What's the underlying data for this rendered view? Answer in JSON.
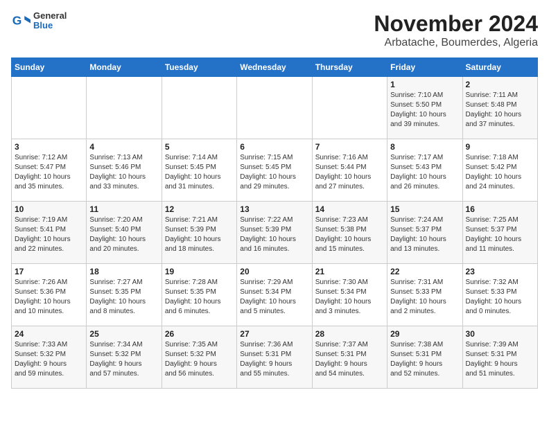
{
  "header": {
    "logo_line1": "General",
    "logo_line2": "Blue",
    "title": "November 2024",
    "subtitle": "Arbatache, Boumerdes, Algeria"
  },
  "weekdays": [
    "Sunday",
    "Monday",
    "Tuesday",
    "Wednesday",
    "Thursday",
    "Friday",
    "Saturday"
  ],
  "weeks": [
    [
      {
        "day": "",
        "info": ""
      },
      {
        "day": "",
        "info": ""
      },
      {
        "day": "",
        "info": ""
      },
      {
        "day": "",
        "info": ""
      },
      {
        "day": "",
        "info": ""
      },
      {
        "day": "1",
        "info": "Sunrise: 7:10 AM\nSunset: 5:50 PM\nDaylight: 10 hours\nand 39 minutes."
      },
      {
        "day": "2",
        "info": "Sunrise: 7:11 AM\nSunset: 5:48 PM\nDaylight: 10 hours\nand 37 minutes."
      }
    ],
    [
      {
        "day": "3",
        "info": "Sunrise: 7:12 AM\nSunset: 5:47 PM\nDaylight: 10 hours\nand 35 minutes."
      },
      {
        "day": "4",
        "info": "Sunrise: 7:13 AM\nSunset: 5:46 PM\nDaylight: 10 hours\nand 33 minutes."
      },
      {
        "day": "5",
        "info": "Sunrise: 7:14 AM\nSunset: 5:45 PM\nDaylight: 10 hours\nand 31 minutes."
      },
      {
        "day": "6",
        "info": "Sunrise: 7:15 AM\nSunset: 5:45 PM\nDaylight: 10 hours\nand 29 minutes."
      },
      {
        "day": "7",
        "info": "Sunrise: 7:16 AM\nSunset: 5:44 PM\nDaylight: 10 hours\nand 27 minutes."
      },
      {
        "day": "8",
        "info": "Sunrise: 7:17 AM\nSunset: 5:43 PM\nDaylight: 10 hours\nand 26 minutes."
      },
      {
        "day": "9",
        "info": "Sunrise: 7:18 AM\nSunset: 5:42 PM\nDaylight: 10 hours\nand 24 minutes."
      }
    ],
    [
      {
        "day": "10",
        "info": "Sunrise: 7:19 AM\nSunset: 5:41 PM\nDaylight: 10 hours\nand 22 minutes."
      },
      {
        "day": "11",
        "info": "Sunrise: 7:20 AM\nSunset: 5:40 PM\nDaylight: 10 hours\nand 20 minutes."
      },
      {
        "day": "12",
        "info": "Sunrise: 7:21 AM\nSunset: 5:39 PM\nDaylight: 10 hours\nand 18 minutes."
      },
      {
        "day": "13",
        "info": "Sunrise: 7:22 AM\nSunset: 5:39 PM\nDaylight: 10 hours\nand 16 minutes."
      },
      {
        "day": "14",
        "info": "Sunrise: 7:23 AM\nSunset: 5:38 PM\nDaylight: 10 hours\nand 15 minutes."
      },
      {
        "day": "15",
        "info": "Sunrise: 7:24 AM\nSunset: 5:37 PM\nDaylight: 10 hours\nand 13 minutes."
      },
      {
        "day": "16",
        "info": "Sunrise: 7:25 AM\nSunset: 5:37 PM\nDaylight: 10 hours\nand 11 minutes."
      }
    ],
    [
      {
        "day": "17",
        "info": "Sunrise: 7:26 AM\nSunset: 5:36 PM\nDaylight: 10 hours\nand 10 minutes."
      },
      {
        "day": "18",
        "info": "Sunrise: 7:27 AM\nSunset: 5:35 PM\nDaylight: 10 hours\nand 8 minutes."
      },
      {
        "day": "19",
        "info": "Sunrise: 7:28 AM\nSunset: 5:35 PM\nDaylight: 10 hours\nand 6 minutes."
      },
      {
        "day": "20",
        "info": "Sunrise: 7:29 AM\nSunset: 5:34 PM\nDaylight: 10 hours\nand 5 minutes."
      },
      {
        "day": "21",
        "info": "Sunrise: 7:30 AM\nSunset: 5:34 PM\nDaylight: 10 hours\nand 3 minutes."
      },
      {
        "day": "22",
        "info": "Sunrise: 7:31 AM\nSunset: 5:33 PM\nDaylight: 10 hours\nand 2 minutes."
      },
      {
        "day": "23",
        "info": "Sunrise: 7:32 AM\nSunset: 5:33 PM\nDaylight: 10 hours\nand 0 minutes."
      }
    ],
    [
      {
        "day": "24",
        "info": "Sunrise: 7:33 AM\nSunset: 5:32 PM\nDaylight: 9 hours\nand 59 minutes."
      },
      {
        "day": "25",
        "info": "Sunrise: 7:34 AM\nSunset: 5:32 PM\nDaylight: 9 hours\nand 57 minutes."
      },
      {
        "day": "26",
        "info": "Sunrise: 7:35 AM\nSunset: 5:32 PM\nDaylight: 9 hours\nand 56 minutes."
      },
      {
        "day": "27",
        "info": "Sunrise: 7:36 AM\nSunset: 5:31 PM\nDaylight: 9 hours\nand 55 minutes."
      },
      {
        "day": "28",
        "info": "Sunrise: 7:37 AM\nSunset: 5:31 PM\nDaylight: 9 hours\nand 54 minutes."
      },
      {
        "day": "29",
        "info": "Sunrise: 7:38 AM\nSunset: 5:31 PM\nDaylight: 9 hours\nand 52 minutes."
      },
      {
        "day": "30",
        "info": "Sunrise: 7:39 AM\nSunset: 5:31 PM\nDaylight: 9 hours\nand 51 minutes."
      }
    ]
  ]
}
